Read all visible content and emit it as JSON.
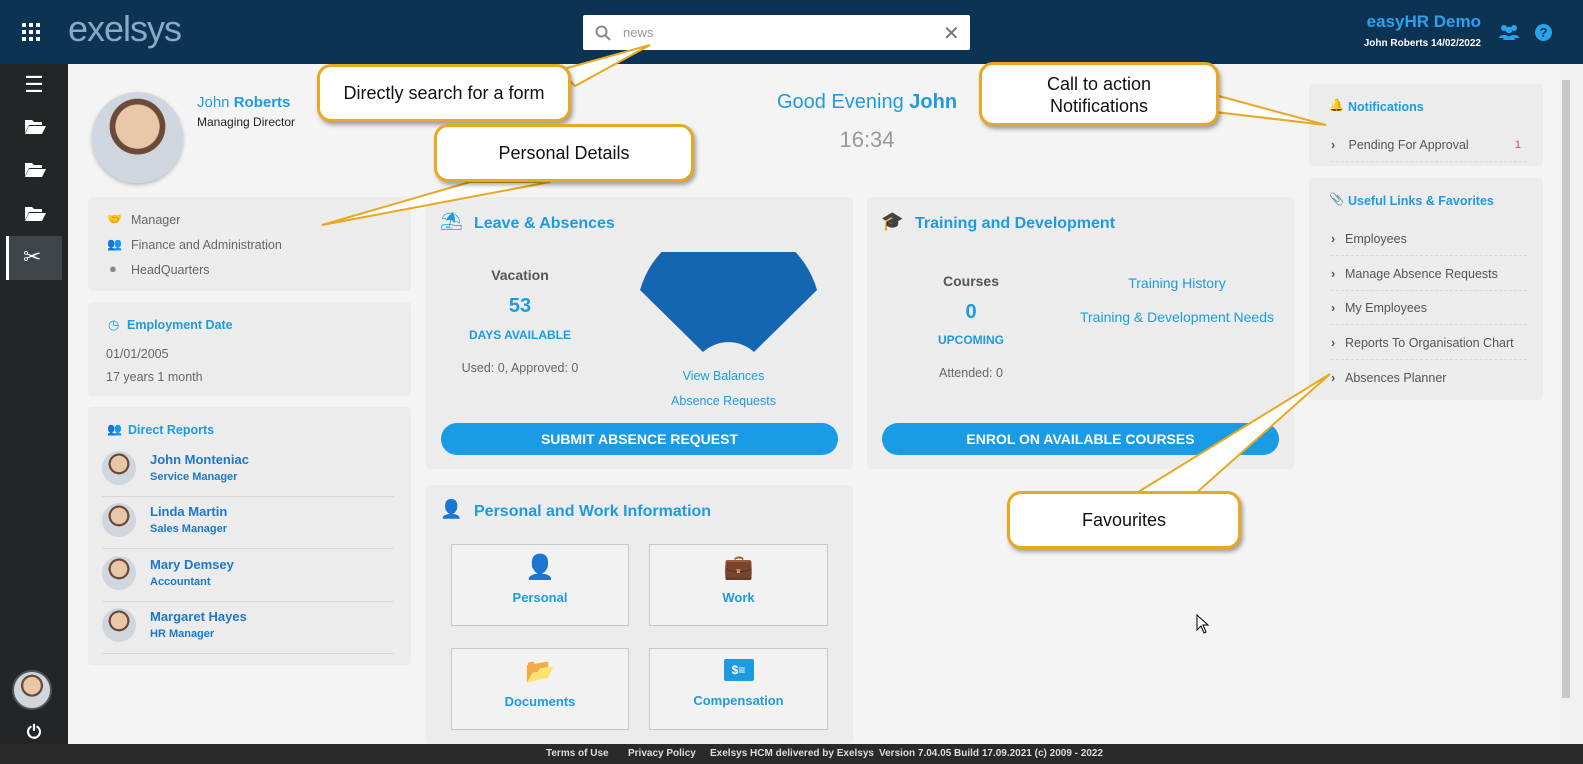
{
  "header": {
    "logo": "exelsys",
    "search_value": "news",
    "company": "easyHR Demo",
    "user_date": "John Roberts 14/02/2022"
  },
  "profile": {
    "first_name": "John",
    "last_name": "Roberts",
    "title": "Managing Director"
  },
  "greeting": {
    "text": "Good Evening",
    "name": "John",
    "time": "16:34"
  },
  "details": {
    "role": "Manager",
    "department": "Finance and Administration",
    "location": "HeadQuarters"
  },
  "employment": {
    "heading": "Employment Date",
    "date": "01/01/2005",
    "duration": "17 years 1 month"
  },
  "direct_reports": {
    "heading": "Direct Reports",
    "people": [
      {
        "name": "John Monteniac",
        "role": "Service Manager"
      },
      {
        "name": "Linda Martin",
        "role": "Sales Manager"
      },
      {
        "name": "Mary Demsey",
        "role": "Accountant"
      },
      {
        "name": "Margaret Hayes",
        "role": "HR Manager"
      }
    ]
  },
  "leave": {
    "heading": "Leave & Absences",
    "type": "Vacation",
    "days": "53",
    "days_label": "DAYS AVAILABLE",
    "used": "Used: 0, Approved: 0",
    "view_balances": "View Balances",
    "absence_requests": "Absence Requests",
    "submit": "SUBMIT ABSENCE REQUEST",
    "gauge_color": "#1466b0"
  },
  "training": {
    "heading": "Training and Development",
    "courses": "Courses",
    "count": "0",
    "count_label": "UPCOMING",
    "attended": "Attended: 0",
    "history": "Training History",
    "needs": "Training & Development Needs",
    "enrol": "ENROL ON AVAILABLE COURSES"
  },
  "personal_work": {
    "heading": "Personal and Work Information",
    "tiles": [
      "Personal",
      "Work",
      "Documents",
      "Compensation"
    ]
  },
  "notifications": {
    "heading": "Notifications",
    "items": [
      {
        "label": "Pending For Approval",
        "count": "1"
      }
    ]
  },
  "links": {
    "heading": "Useful Links & Favorites",
    "items": [
      "Employees",
      "Manage Absence Requests",
      "My Employees",
      "Reports To Organisation Chart",
      "Absences Planner"
    ]
  },
  "callouts": {
    "search": "Directly search for a form",
    "personal": "Personal Details",
    "notify_line1": "Call to action",
    "notify_line2": "Notifications",
    "favourites": "Favourites"
  },
  "footer": {
    "terms": "Terms of Use",
    "privacy": "Privacy Policy",
    "delivered": "Exelsys HCM delivered by Exelsys",
    "version": "Version 7.04.05 Build 17.09.2021 (c) 2009 - 2022"
  },
  "colors": {
    "accent": "#1e9be0",
    "topbar": "#0d3354",
    "callout_border": "#e8a820"
  }
}
